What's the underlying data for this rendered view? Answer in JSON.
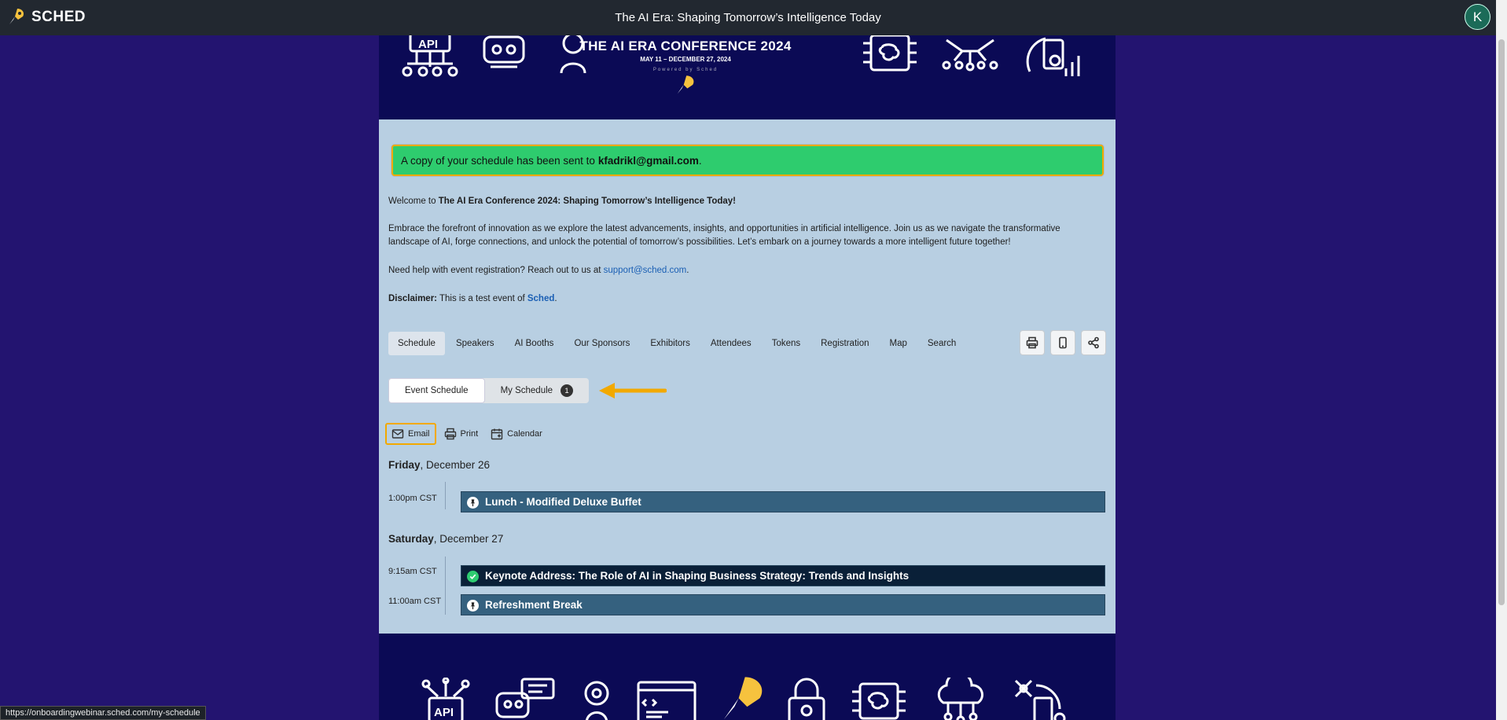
{
  "topbar": {
    "logo_text": "SCHED",
    "title": "The AI Era: Shaping Tomorrow’s Intelligence Today",
    "avatar_initial": "K"
  },
  "banner": {
    "title": "THE AI ERA CONFERENCE 2024",
    "dates": "MAY 11 – DECEMBER 27, 2024",
    "powered": "Powered by Sched"
  },
  "flash": {
    "message": "A copy of your schedule has been sent to",
    "email": "kfadrikl@gmail.com",
    "suffix": "."
  },
  "intro": {
    "welcome_prefix": "Welcome to ",
    "welcome_event": "The AI Era Conference 2024: Shaping Tomorrow’s Intelligence Today!",
    "paragraph": "Embrace the forefront of innovation as we explore the latest advancements, insights, and opportunities in artificial intelligence. Join us as we navigate the transformative landscape of AI, forge connections, and unlock the potential of tomorrow’s possibilities. Let’s embark on a journey towards a more intelligent future together!",
    "help_prefix": "Need help with event registration? Reach out to us at ",
    "help_email": "support@sched.com",
    "help_suffix": ".",
    "disclaimer_label": "Disclaimer:",
    "disclaimer_text": " This is a test event of ",
    "disclaimer_link": "Sched",
    "disclaimer_suffix": "."
  },
  "nav": {
    "items": [
      "Schedule",
      "Speakers",
      "AI Booths",
      "Our Sponsors",
      "Exhibitors",
      "Attendees",
      "Tokens",
      "Registration",
      "Map",
      "Search"
    ],
    "active": "Schedule",
    "tools": [
      "print-icon",
      "mobile-icon",
      "share-icon"
    ]
  },
  "segmented": {
    "event_schedule": "Event Schedule",
    "my_schedule": "My Schedule",
    "my_schedule_count": "1"
  },
  "actions": {
    "email": "Email",
    "print": "Print",
    "calendar": "Calendar"
  },
  "schedule": {
    "days": [
      {
        "weekday": "Friday",
        "date": ", December 26",
        "sessions": [
          {
            "time": "1:00pm CST",
            "title": "Lunch - Modified Deluxe Buffet",
            "icon": "pin-icon"
          }
        ]
      },
      {
        "weekday": "Saturday",
        "date": ", December 27",
        "sessions": [
          {
            "time": "9:15am CST",
            "title": "Keynote Address: The Role of AI in Shaping Business Strategy: Trends and Insights",
            "icon": "check-icon"
          },
          {
            "time": "11:00am CST",
            "title": "Refreshment Break",
            "icon": "pin-icon"
          }
        ]
      }
    ]
  },
  "statusbar": {
    "url": "https://onboardingwebinar.sched.com/my-schedule"
  },
  "colors": {
    "page_bg": "#231470",
    "banner_bg": "#0b0a55",
    "panel_bg": "#b8cfe2",
    "flash_bg": "#2ecc6e",
    "highlight": "#f2a900",
    "session_bg": "#35617f",
    "session_selected_bg": "#0a2038"
  }
}
